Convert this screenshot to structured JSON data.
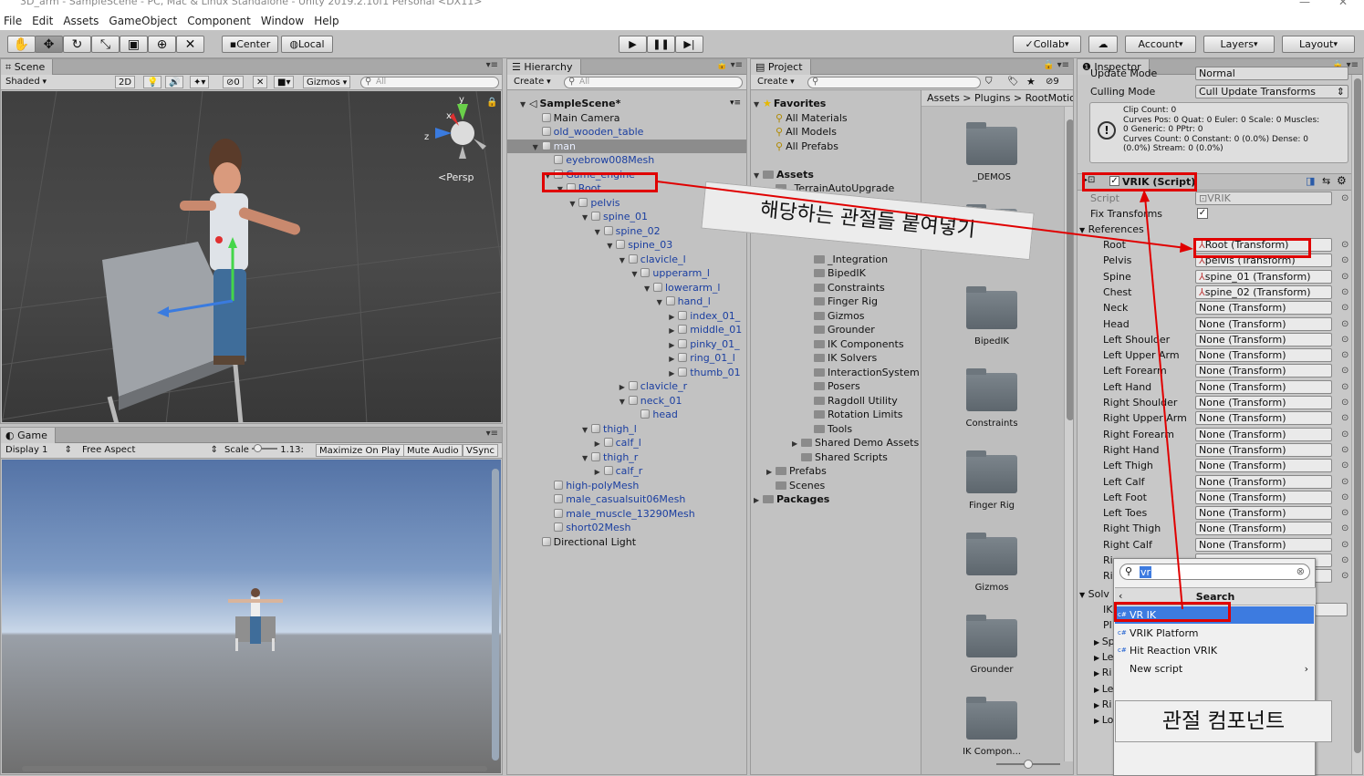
{
  "window": {
    "title": "3D_arm - SampleScene - PC, Mac & Linux Standalone - Unity 2019.2.10f1 Personal <DX11>",
    "minimize": "—",
    "close": "✕"
  },
  "menu": [
    "File",
    "Edit",
    "Assets",
    "GameObject",
    "Component",
    "Window",
    "Help"
  ],
  "toolbar": {
    "center": "Center",
    "local": "Local",
    "collab": "Collab",
    "account": "Account",
    "layers": "Layers",
    "layout": "Layout"
  },
  "scene": {
    "tab": "Scene",
    "shading": "Shaded",
    "mode2d": "2D",
    "gizmos": "Gizmos",
    "search": "All",
    "persp": "Persp",
    "hidden_count": "0",
    "axis_y": "y",
    "axis_x": "x",
    "axis_z": "z"
  },
  "game": {
    "tab": "Game",
    "display": "Display 1",
    "aspect": "Free Aspect",
    "scale_label": "Scale",
    "scale_value": "1.13:",
    "maximize": "Maximize On Play",
    "mute": "Mute Audio",
    "vsync": "VSync"
  },
  "hierarchy": {
    "tab": "Hierarchy",
    "create": "Create",
    "search": "All",
    "items": [
      {
        "label": "SampleScene*",
        "depth": 0,
        "arrow": "▼",
        "bold": true,
        "scene": true
      },
      {
        "label": "Main Camera",
        "depth": 1,
        "arrow": ""
      },
      {
        "label": "old_wooden_table",
        "depth": 1,
        "arrow": "",
        "blue": true
      },
      {
        "label": "man",
        "depth": 1,
        "arrow": "▼",
        "blue": true,
        "selected": true
      },
      {
        "label": "eyebrow008Mesh",
        "depth": 2,
        "arrow": "",
        "blue": true
      },
      {
        "label": "Game_engine",
        "depth": 2,
        "arrow": "▼",
        "blue": true
      },
      {
        "label": "Root",
        "depth": 3,
        "arrow": "▼",
        "blue": true
      },
      {
        "label": "pelvis",
        "depth": 4,
        "arrow": "▼",
        "blue": true
      },
      {
        "label": "spine_01",
        "depth": 5,
        "arrow": "▼",
        "blue": true
      },
      {
        "label": "spine_02",
        "depth": 6,
        "arrow": "▼",
        "blue": true
      },
      {
        "label": "spine_03",
        "depth": 7,
        "arrow": "▼",
        "blue": true
      },
      {
        "label": "clavicle_l",
        "depth": 8,
        "arrow": "▼",
        "blue": true
      },
      {
        "label": "upperarm_l",
        "depth": 9,
        "arrow": "▼",
        "blue": true
      },
      {
        "label": "lowerarm_l",
        "depth": 10,
        "arrow": "▼",
        "blue": true
      },
      {
        "label": "hand_l",
        "depth": 11,
        "arrow": "▼",
        "blue": true
      },
      {
        "label": "index_01_",
        "depth": 12,
        "arrow": "▶",
        "blue": true
      },
      {
        "label": "middle_01",
        "depth": 12,
        "arrow": "▶",
        "blue": true
      },
      {
        "label": "pinky_01_",
        "depth": 12,
        "arrow": "▶",
        "blue": true
      },
      {
        "label": "ring_01_l",
        "depth": 12,
        "arrow": "▶",
        "blue": true
      },
      {
        "label": "thumb_01",
        "depth": 12,
        "arrow": "▶",
        "blue": true
      },
      {
        "label": "clavicle_r",
        "depth": 8,
        "arrow": "▶",
        "blue": true
      },
      {
        "label": "neck_01",
        "depth": 8,
        "arrow": "▼",
        "blue": true
      },
      {
        "label": "head",
        "depth": 9,
        "arrow": "",
        "blue": true
      },
      {
        "label": "thigh_l",
        "depth": 5,
        "arrow": "▼",
        "blue": true
      },
      {
        "label": "calf_l",
        "depth": 6,
        "arrow": "▶",
        "blue": true
      },
      {
        "label": "thigh_r",
        "depth": 5,
        "arrow": "▼",
        "blue": true
      },
      {
        "label": "calf_r",
        "depth": 6,
        "arrow": "▶",
        "blue": true
      },
      {
        "label": "high-polyMesh",
        "depth": 2,
        "arrow": "",
        "blue": true
      },
      {
        "label": "male_casualsuit06Mesh",
        "depth": 2,
        "arrow": "",
        "blue": true
      },
      {
        "label": "male_muscle_13290Mesh",
        "depth": 2,
        "arrow": "",
        "blue": true
      },
      {
        "label": "short02Mesh",
        "depth": 2,
        "arrow": "",
        "blue": true
      },
      {
        "label": "Directional Light",
        "depth": 1,
        "arrow": ""
      }
    ]
  },
  "project": {
    "tab": "Project",
    "create": "Create",
    "breadcrumb": [
      "Assets",
      "Plugins",
      "RootMotio"
    ],
    "filter_count": "9",
    "tree": [
      {
        "label": "Favorites",
        "depth": 0,
        "arrow": "▼",
        "bold": true,
        "icon": "star"
      },
      {
        "label": "All Materials",
        "depth": 1,
        "arrow": "",
        "icon": "search"
      },
      {
        "label": "All Models",
        "depth": 1,
        "arrow": "",
        "icon": "search"
      },
      {
        "label": "All Prefabs",
        "depth": 1,
        "arrow": "",
        "icon": "search"
      },
      {
        "label": "",
        "depth": 0,
        "arrow": "",
        "icon": "none"
      },
      {
        "label": "Assets",
        "depth": 0,
        "arrow": "▼",
        "bold": true,
        "icon": "folder"
      },
      {
        "label": "_TerrainAutoUpgrade",
        "depth": 1,
        "arrow": "",
        "icon": "folder"
      },
      {
        "label": "Plugins",
        "depth": 1,
        "arrow": "▼",
        "icon": "folder"
      },
      {
        "label": "RootMotion",
        "depth": 2,
        "arrow": "▼",
        "icon": "folder"
      },
      {
        "label": "",
        "depth": 0,
        "arrow": "",
        "icon": "none"
      },
      {
        "label": "",
        "depth": 0,
        "arrow": "",
        "icon": "none"
      },
      {
        "label": "_Integration",
        "depth": 4,
        "arrow": "",
        "icon": "folder"
      },
      {
        "label": "BipedIK",
        "depth": 4,
        "arrow": "",
        "icon": "folder"
      },
      {
        "label": "Constraints",
        "depth": 4,
        "arrow": "",
        "icon": "folder"
      },
      {
        "label": "Finger Rig",
        "depth": 4,
        "arrow": "",
        "icon": "folder"
      },
      {
        "label": "Gizmos",
        "depth": 4,
        "arrow": "",
        "icon": "folder"
      },
      {
        "label": "Grounder",
        "depth": 4,
        "arrow": "",
        "icon": "folder"
      },
      {
        "label": "IK Components",
        "depth": 4,
        "arrow": "",
        "icon": "folder"
      },
      {
        "label": "IK Solvers",
        "depth": 4,
        "arrow": "",
        "icon": "folder"
      },
      {
        "label": "InteractionSystem",
        "depth": 4,
        "arrow": "",
        "icon": "folder"
      },
      {
        "label": "Posers",
        "depth": 4,
        "arrow": "",
        "icon": "folder"
      },
      {
        "label": "Ragdoll Utility",
        "depth": 4,
        "arrow": "",
        "icon": "folder"
      },
      {
        "label": "Rotation Limits",
        "depth": 4,
        "arrow": "",
        "icon": "folder"
      },
      {
        "label": "Tools",
        "depth": 4,
        "arrow": "",
        "icon": "folder"
      },
      {
        "label": "Shared Demo Assets",
        "depth": 3,
        "arrow": "▶",
        "icon": "folder"
      },
      {
        "label": "Shared Scripts",
        "depth": 3,
        "arrow": "",
        "icon": "folder"
      },
      {
        "label": "Prefabs",
        "depth": 1,
        "arrow": "▶",
        "icon": "folder"
      },
      {
        "label": "Scenes",
        "depth": 1,
        "arrow": "",
        "icon": "folder"
      },
      {
        "label": "Packages",
        "depth": 0,
        "arrow": "▶",
        "bold": true,
        "icon": "folder"
      }
    ],
    "folders": [
      "_DEMOS",
      "",
      "BipedIK",
      "Constraints",
      "Finger Rig",
      "Gizmos",
      "Grounder",
      "IK Compon..."
    ]
  },
  "inspector": {
    "tab": "Inspector",
    "update_mode_label": "Update Mode",
    "update_mode_value": "Normal",
    "culling_label": "Culling Mode",
    "culling_value": "Cull Update Transforms",
    "info": [
      "Clip Count: 0",
      "Curves Pos: 0 Quat: 0 Euler: 0 Scale: 0 Muscles:",
      "0 Generic: 0 PPtr: 0",
      "Curves Count: 0 Constant: 0 (0.0%) Dense: 0",
      "(0.0%) Stream: 0 (0.0%)"
    ],
    "component_title": "VRIK (Script)",
    "script_label": "Script",
    "script_value": "VRIK",
    "fix_label": "Fix Transforms",
    "references_label": "References",
    "refs": [
      {
        "label": "Root",
        "value": "Root (Transform)",
        "icon": true
      },
      {
        "label": "Pelvis",
        "value": "pelvis (Transform)",
        "icon": true
      },
      {
        "label": "Spine",
        "value": "spine_01 (Transform)",
        "icon": true
      },
      {
        "label": "Chest",
        "value": "spine_02 (Transform)",
        "icon": true
      },
      {
        "label": "Neck",
        "value": "None (Transform)"
      },
      {
        "label": "Head",
        "value": "None (Transform)"
      },
      {
        "label": "Left Shoulder",
        "value": "None (Transform)"
      },
      {
        "label": "Left Upper Arm",
        "value": "None (Transform)"
      },
      {
        "label": "Left Forearm",
        "value": "None (Transform)"
      },
      {
        "label": "Left Hand",
        "value": "None (Transform)"
      },
      {
        "label": "Right Shoulder",
        "value": "None (Transform)"
      },
      {
        "label": "Right Upper Arm",
        "value": "None (Transform)"
      },
      {
        "label": "Right Forearm",
        "value": "None (Transform)"
      },
      {
        "label": "Right Hand",
        "value": "None (Transform)"
      },
      {
        "label": "Left Thigh",
        "value": "None (Transform)"
      },
      {
        "label": "Left Calf",
        "value": "None (Transform)"
      },
      {
        "label": "Left Foot",
        "value": "None (Transform)"
      },
      {
        "label": "Left Toes",
        "value": "None (Transform)"
      },
      {
        "label": "Right Thigh",
        "value": "None (Transform)"
      },
      {
        "label": "Right Calf",
        "value": "None (Transform)"
      },
      {
        "label": "Ri",
        "value": ""
      },
      {
        "label": "Ri",
        "value": ""
      }
    ],
    "solver_label": "Solv",
    "solver_rows": [
      "IK",
      "Pl",
      "Sp",
      "Le",
      "Ri",
      "Le",
      "Ri",
      "Lo"
    ]
  },
  "popup": {
    "search_value": "vr",
    "header": "Search",
    "items": [
      "VR IK",
      "VRIK Platform",
      "Hit Reaction VRIK",
      "New script"
    ]
  },
  "annotations": {
    "paste": "해당하는 관절들 붙여넣기",
    "component": "관절 컴포넌트"
  },
  "colors": {
    "selection": "#3d7be0",
    "annotation_red": "#e00000",
    "prefab_blue": "#1a3ea0"
  }
}
